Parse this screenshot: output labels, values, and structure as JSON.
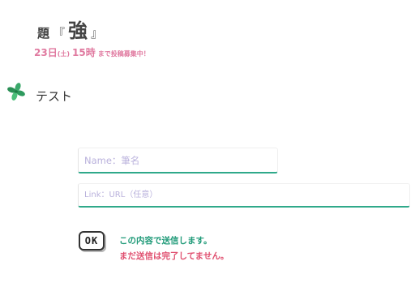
{
  "header": {
    "theme_label": "題",
    "bracket_open": "『",
    "theme_word": "強",
    "bracket_close": "』"
  },
  "deadline": {
    "day": "23日",
    "weekday": "(土)",
    "hour": "15時",
    "text": "まで投稿募集中！"
  },
  "post": {
    "title": "テスト",
    "icon": "clover-icon"
  },
  "form": {
    "name_placeholder": "Name：筆名",
    "name_value": "",
    "link_placeholder": "Link：URL（任意）",
    "link_value": "",
    "ok_label": "OK"
  },
  "status": {
    "line1": "この内容で送信します。",
    "line2": "まだ送信は完了してません。"
  },
  "colors": {
    "accent_green": "#2fa98a",
    "status_green": "#1f9a78",
    "status_red": "#e05070",
    "deadline_pink": "#e07aa0"
  }
}
